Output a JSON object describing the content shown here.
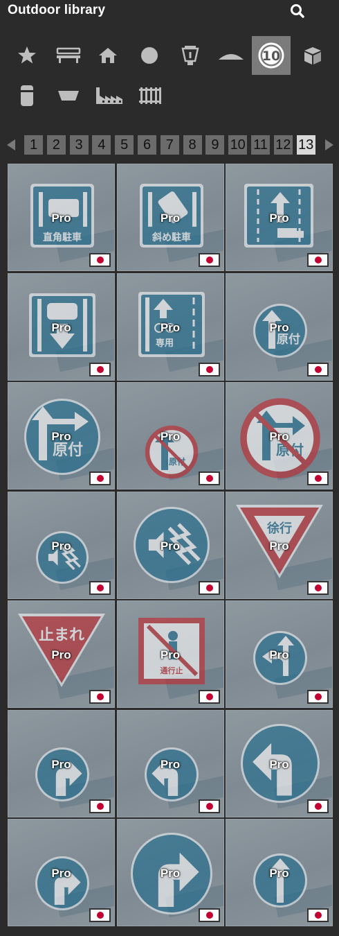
{
  "header": {
    "title": "Outdoor library"
  },
  "categories": [
    {
      "icon": "star-icon",
      "active": false
    },
    {
      "icon": "bench-icon",
      "active": false
    },
    {
      "icon": "house-icon",
      "active": false
    },
    {
      "icon": "circle-icon",
      "active": false
    },
    {
      "icon": "lantern-icon",
      "active": false
    },
    {
      "icon": "mound-icon",
      "active": false
    },
    {
      "icon": "road-sign-icon",
      "active": true,
      "label": "10"
    },
    {
      "icon": "crate-icon",
      "active": false
    },
    {
      "icon": "bollard-icon",
      "active": false
    },
    {
      "icon": "planter-icon",
      "active": false
    },
    {
      "icon": "factory-icon",
      "active": false
    },
    {
      "icon": "fence-icon",
      "active": false
    }
  ],
  "pager": {
    "pages": [
      "1",
      "2",
      "3",
      "4",
      "5",
      "6",
      "7",
      "8",
      "9",
      "10",
      "11",
      "12",
      "13"
    ],
    "current": "13"
  },
  "tiles": [
    {
      "badge": "Pro",
      "sign": "sq-parking-right-angle",
      "text": "直角駐車"
    },
    {
      "badge": "Pro",
      "sign": "sq-parking-diagonal",
      "text": "斜め駐車"
    },
    {
      "badge": "Pro",
      "sign": "sq-lane-truck",
      "text": ""
    },
    {
      "badge": "Pro",
      "sign": "sq-bus-lane",
      "text": ""
    },
    {
      "badge": "Pro",
      "sign": "sq-bicycle-lane",
      "text": "専用"
    },
    {
      "badge": "Pro",
      "sign": "round-moped-small",
      "text": "原付"
    },
    {
      "badge": "Pro",
      "sign": "round-moped-large",
      "text": "原付"
    },
    {
      "badge": "Pro",
      "sign": "round-moped-prohibit-small",
      "text": "原付"
    },
    {
      "badge": "Pro",
      "sign": "round-moped-prohibit-large",
      "text": "原付"
    },
    {
      "badge": "Pro",
      "sign": "round-horn-small",
      "text": ""
    },
    {
      "badge": "Pro",
      "sign": "round-horn-large",
      "text": ""
    },
    {
      "badge": "Pro",
      "sign": "tri-slow",
      "text": "徐行"
    },
    {
      "badge": "Pro",
      "sign": "tri-stop",
      "text": "止まれ"
    },
    {
      "badge": "Pro",
      "sign": "sq-no-pedestrian",
      "text": "通行止"
    },
    {
      "badge": "Pro",
      "sign": "round-straight-left",
      "text": ""
    },
    {
      "badge": "Pro",
      "sign": "round-straight-right",
      "text": ""
    },
    {
      "badge": "Pro",
      "sign": "round-left-small",
      "text": ""
    },
    {
      "badge": "Pro",
      "sign": "round-left-large",
      "text": ""
    },
    {
      "badge": "Pro",
      "sign": "round-right-small",
      "text": ""
    },
    {
      "badge": "Pro",
      "sign": "round-right-large",
      "text": ""
    },
    {
      "badge": "Pro",
      "sign": "round-straight",
      "text": ""
    }
  ],
  "colors": {
    "sign_blue": "#1f6d8e",
    "sign_red": "#c0282e",
    "panel_bg": "#2b2b2b",
    "tile_bg": "#85909a"
  }
}
